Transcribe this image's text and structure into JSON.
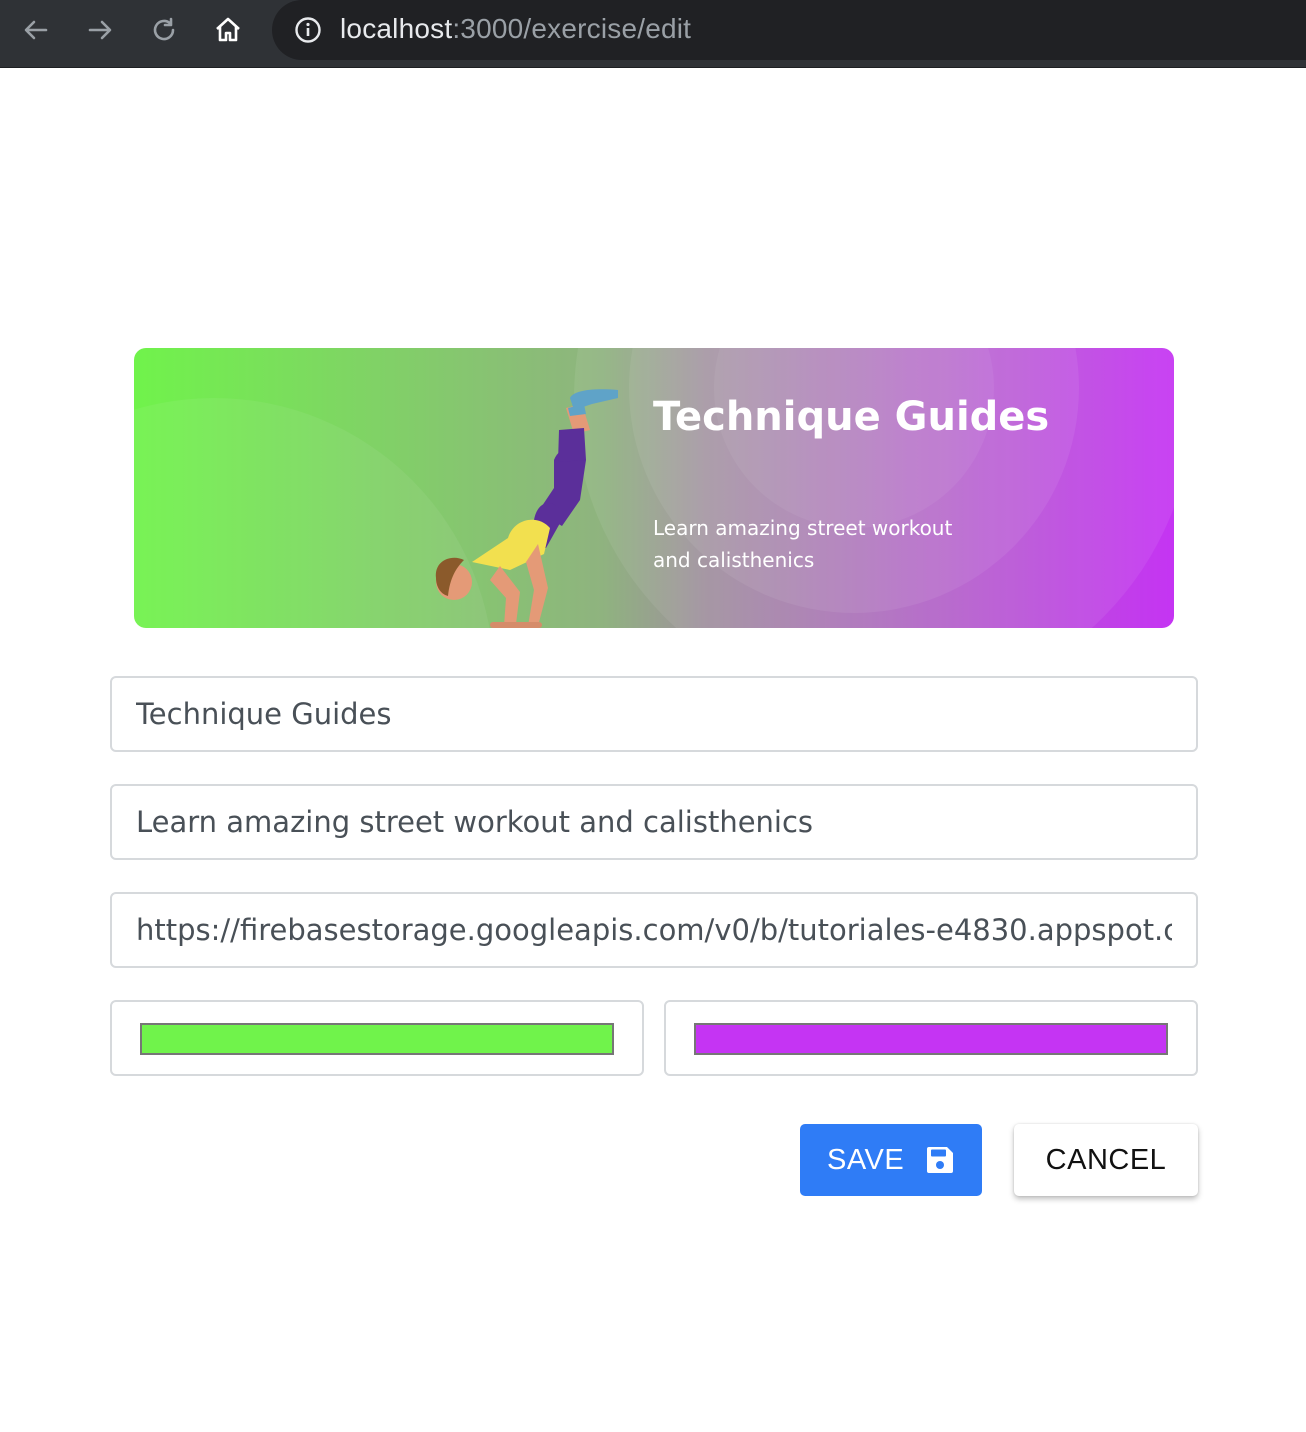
{
  "browser": {
    "url_host": "localhost",
    "url_path": ":3000/exercise/edit",
    "icons": [
      "back-arrow-icon",
      "forward-arrow-icon",
      "reload-icon",
      "home-icon",
      "info-icon"
    ]
  },
  "banner": {
    "title": "Technique Guides",
    "subtitle": "Learn amazing street workout and calisthenics",
    "color_left": "#70f34b",
    "color_right": "#c534f3"
  },
  "form": {
    "title_value": "Technique Guides",
    "description_value": "Learn amazing street workout and calisthenics",
    "image_url_value": "https://firebasestorage.googleapis.com/v0/b/tutoriales-e4830.appspot.c",
    "left_color": "#70f34b",
    "right_color": "#c534f3"
  },
  "actions": {
    "save_label": "SAVE",
    "cancel_label": "CANCEL",
    "save_color": "#2f7cf6"
  }
}
